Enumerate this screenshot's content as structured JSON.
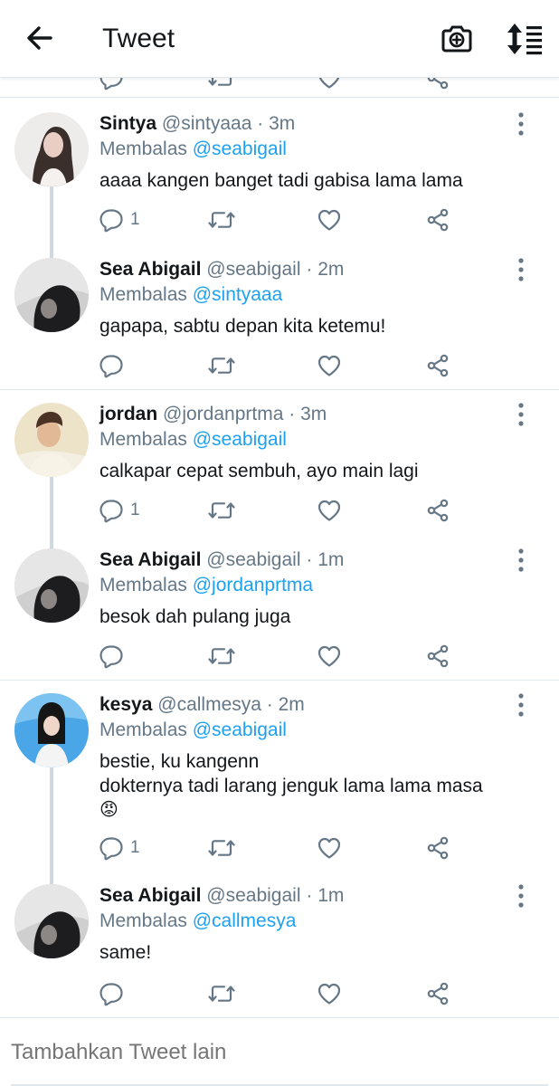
{
  "header": {
    "title": "Tweet",
    "back_icon": "arrow-left-icon",
    "camera_icon": "camera-plus-icon",
    "sort_icon": "sort-list-icon"
  },
  "colors": {
    "accent": "#1da1f2",
    "secondary_text": "#657786",
    "primary_text": "#14171a",
    "divider": "#e1e8ed",
    "thread_line": "#cfd9de"
  },
  "reply_prefix": "Membalas",
  "threads": [
    {
      "tweets": [
        {
          "name": "Sintya",
          "handle": "@sintyaaa",
          "dot": "·",
          "time": "3m",
          "reply_to": "@seabigail",
          "text": "aaaa kangen banget tadi gabisa lama lama",
          "reply_count": "1"
        },
        {
          "name": "Sea Abigail",
          "handle": "@seabigail",
          "dot": "·",
          "time": "2m",
          "reply_to": "@sintyaaa",
          "text": "gapapa, sabtu depan kita ketemu!",
          "reply_count": ""
        }
      ]
    },
    {
      "tweets": [
        {
          "name": "jordan",
          "handle": "@jordanprtma",
          "dot": "·",
          "time": "3m",
          "reply_to": "@seabigail",
          "text": "calkapar cepat sembuh, ayo main lagi",
          "reply_count": "1"
        },
        {
          "name": "Sea Abigail",
          "handle": "@seabigail",
          "dot": "·",
          "time": "1m",
          "reply_to": "@jordanprtma",
          "text": "besok dah pulang juga",
          "reply_count": ""
        }
      ]
    },
    {
      "tweets": [
        {
          "name": "kesya",
          "handle": "@callmesya",
          "dot": "·",
          "time": "2m",
          "reply_to": "@seabigail",
          "text_line1": "bestie, ku kangenn",
          "text_line2": "dokternya tadi larang jenguk lama lama masa",
          "emoji": "😡",
          "reply_count": "1"
        },
        {
          "name": "Sea Abigail",
          "handle": "@seabigail",
          "dot": "·",
          "time": "1m",
          "reply_to": "@callmesya",
          "text": "same!",
          "reply_count": ""
        }
      ]
    }
  ],
  "compose": {
    "placeholder": "Tambahkan Tweet lain"
  }
}
